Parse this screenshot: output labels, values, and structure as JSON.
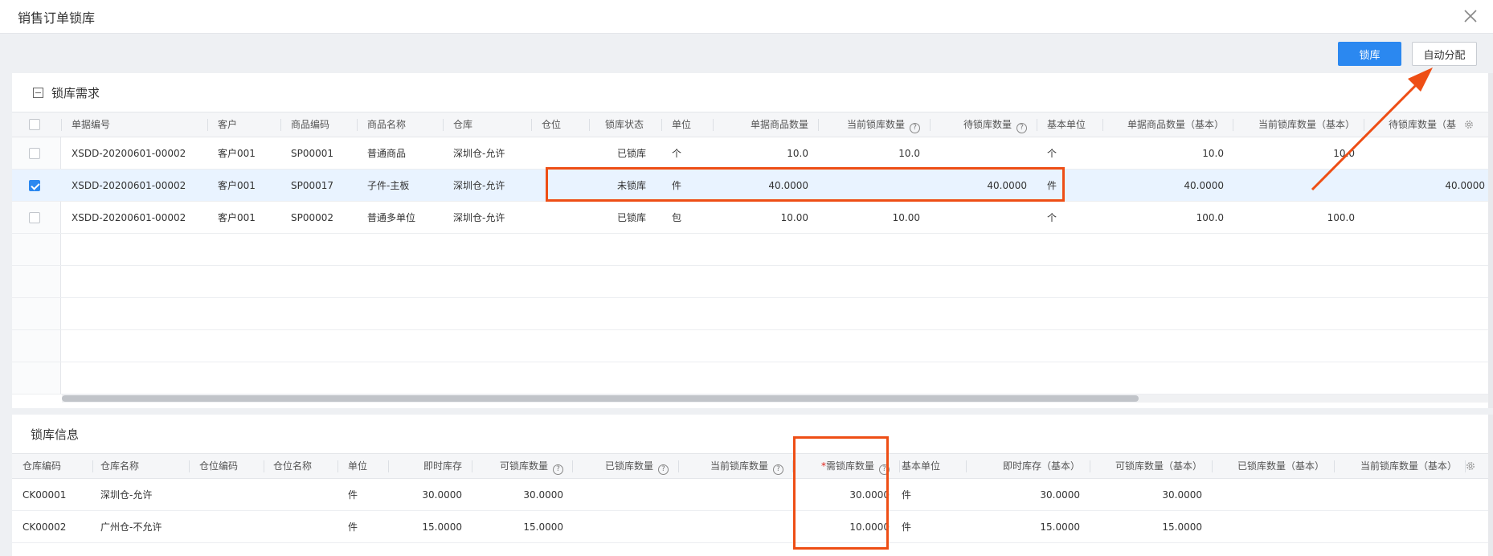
{
  "dialog": {
    "title": "销售订单锁库"
  },
  "toolbar": {
    "lock_label": "锁库",
    "auto_assign_label": "自动分配"
  },
  "demand": {
    "title": "锁库需求",
    "columns": [
      "单据编号",
      "客户",
      "商品编码",
      "商品名称",
      "仓库",
      "仓位",
      "锁库状态",
      "单位",
      "单据商品数量",
      "当前锁库数量",
      "待锁库数量",
      "基本单位",
      "单据商品数量（基本）",
      "当前锁库数量（基本）",
      "待锁库数量（基"
    ],
    "rows": [
      {
        "checked": false,
        "cells": [
          "XSDD-20200601-00002",
          "客户001",
          "SP00001",
          "普通商品",
          "深圳仓-允许",
          "",
          "已锁库",
          "个",
          "10.0",
          "10.0",
          "",
          "个",
          "10.0",
          "10.0",
          ""
        ]
      },
      {
        "checked": true,
        "cells": [
          "XSDD-20200601-00002",
          "客户001",
          "SP00017",
          "子件-主板",
          "深圳仓-允许",
          "",
          "未锁库",
          "件",
          "40.0000",
          "",
          "40.0000",
          "件",
          "40.0000",
          "",
          "40.0000"
        ]
      },
      {
        "checked": false,
        "cells": [
          "XSDD-20200601-00002",
          "客户001",
          "SP00002",
          "普通多单位",
          "深圳仓-允许",
          "",
          "已锁库",
          "包",
          "10.00",
          "10.00",
          "",
          "个",
          "100.0",
          "100.0",
          ""
        ]
      }
    ]
  },
  "lockinfo": {
    "title": "锁库信息",
    "columns": [
      "仓库编码",
      "仓库名称",
      "仓位编码",
      "仓位名称",
      "单位",
      "即时库存",
      "可锁库数量",
      "已锁库数量",
      "当前锁库数量",
      "需锁库数量",
      "基本单位",
      "即时库存（基本）",
      "可锁库数量（基本）",
      "已锁库数量（基本）",
      "当前锁库数量（基本）"
    ],
    "required_mark": "*",
    "rows": [
      {
        "cells": [
          "CK00001",
          "深圳仓-允许",
          "",
          "",
          "件",
          "30.0000",
          "30.0000",
          "",
          "",
          "30.0000",
          "件",
          "30.0000",
          "30.0000",
          "",
          ""
        ]
      },
      {
        "cells": [
          "CK00002",
          "广州仓-不允许",
          "",
          "",
          "件",
          "15.0000",
          "15.0000",
          "",
          "",
          "10.0000",
          "件",
          "15.0000",
          "15.0000",
          "",
          ""
        ]
      }
    ]
  },
  "icons": {
    "close": "close-icon",
    "settings": "gear-icon",
    "help": "question-circle-icon",
    "collapse": "collapse-minus-icon"
  },
  "colors": {
    "primary": "#2b88f0",
    "annotation": "#ee4e15",
    "selected_row": "#e9f3ff"
  }
}
